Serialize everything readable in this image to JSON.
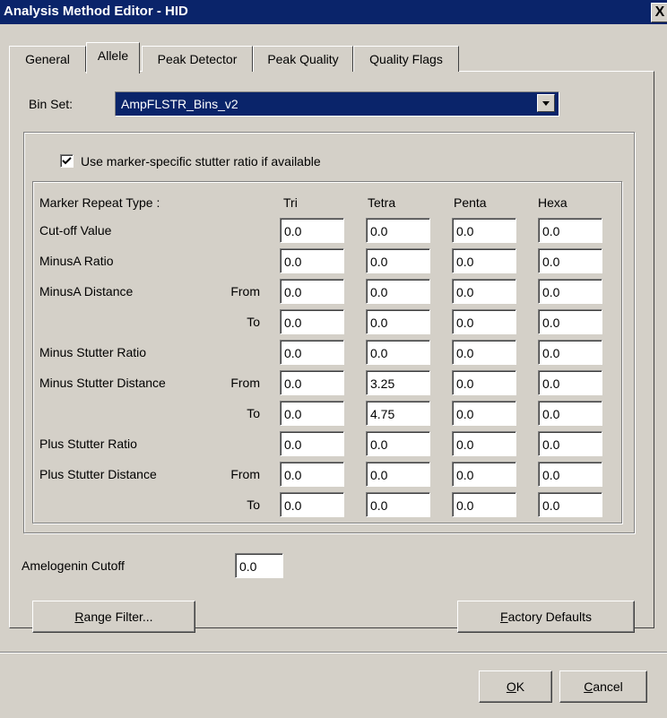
{
  "window": {
    "title": "Analysis Method Editor - HID",
    "close_glyph": "X"
  },
  "tabs": [
    {
      "label": "General",
      "active": false
    },
    {
      "label": "Allele",
      "active": true
    },
    {
      "label": "Peak Detector",
      "active": false
    },
    {
      "label": "Peak Quality",
      "active": false
    },
    {
      "label": "Quality Flags",
      "active": false
    }
  ],
  "bin_set": {
    "label": "Bin Set:",
    "value": "AmpFLSTR_Bins_v2"
  },
  "stutter_checkbox": {
    "label": "Use marker-specific stutter ratio if available",
    "checked": true
  },
  "table": {
    "header_label": "Marker Repeat Type :",
    "columns": [
      "Tri",
      "Tetra",
      "Penta",
      "Hexa"
    ],
    "rows": [
      {
        "label": "Cut-off Value",
        "sub": "",
        "values": [
          "0.0",
          "0.0",
          "0.0",
          "0.0"
        ]
      },
      {
        "label": "MinusA Ratio",
        "sub": "",
        "values": [
          "0.0",
          "0.0",
          "0.0",
          "0.0"
        ]
      },
      {
        "label": "MinusA Distance",
        "sub": "From",
        "values": [
          "0.0",
          "0.0",
          "0.0",
          "0.0"
        ]
      },
      {
        "label": "",
        "sub": "To",
        "values": [
          "0.0",
          "0.0",
          "0.0",
          "0.0"
        ]
      },
      {
        "label": "Minus Stutter Ratio",
        "sub": "",
        "values": [
          "0.0",
          "0.0",
          "0.0",
          "0.0"
        ]
      },
      {
        "label": "Minus Stutter Distance",
        "sub": "From",
        "values": [
          "0.0",
          "3.25",
          "0.0",
          "0.0"
        ]
      },
      {
        "label": "",
        "sub": "To",
        "values": [
          "0.0",
          "4.75",
          "0.0",
          "0.0"
        ]
      },
      {
        "label": "Plus Stutter Ratio",
        "sub": "",
        "values": [
          "0.0",
          "0.0",
          "0.0",
          "0.0"
        ]
      },
      {
        "label": "Plus Stutter Distance",
        "sub": "From",
        "values": [
          "0.0",
          "0.0",
          "0.0",
          "0.0"
        ]
      },
      {
        "label": "",
        "sub": "To",
        "values": [
          "0.0",
          "0.0",
          "0.0",
          "0.0"
        ]
      }
    ]
  },
  "amelogenin": {
    "label": "Amelogenin Cutoff",
    "value": "0.0"
  },
  "buttons": {
    "range_filter": {
      "mnemonic": "R",
      "rest": "ange Filter..."
    },
    "factory_defaults": {
      "mnemonic": "F",
      "rest": "actory Defaults"
    },
    "ok": {
      "mnemonic": "O",
      "rest": "K"
    },
    "cancel": {
      "mnemonic": "C",
      "rest": "ancel"
    }
  }
}
